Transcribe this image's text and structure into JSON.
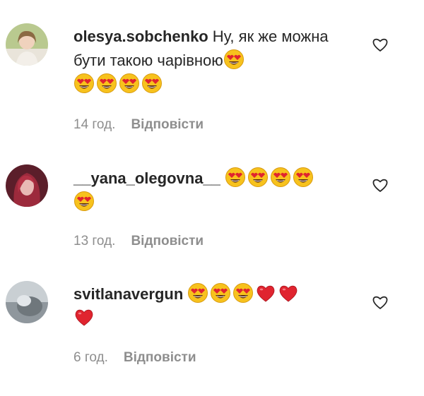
{
  "comments": [
    {
      "username": "olesya.sobchenko",
      "text": "Ну, як же можна бути такою чарівною",
      "emojis_inline": [
        "heart-eyes"
      ],
      "emojis_after": [
        "heart-eyes",
        "heart-eyes",
        "heart-eyes",
        "heart-eyes"
      ],
      "time": "14 год.",
      "reply_label": "Відповісти",
      "avatar_icon": "avatar-photo-blonde"
    },
    {
      "username": "__yana_olegovna__",
      "text": "",
      "emojis_inline": [
        "heart-eyes",
        "heart-eyes",
        "heart-eyes",
        "heart-eyes",
        "heart-eyes"
      ],
      "time": "13 год.",
      "reply_label": "Відповісти",
      "avatar_icon": "avatar-photo-redhair"
    },
    {
      "username": "svitlanavergun",
      "text": "",
      "emojis_inline": [
        "heart-eyes",
        "heart-eyes",
        "heart-eyes",
        "red-heart",
        "red-heart",
        "red-heart"
      ],
      "time": "6 год.",
      "reply_label": "Відповісти",
      "avatar_icon": "avatar-photo-grey"
    }
  ],
  "icons": {
    "like": "heart-outline-icon",
    "emoji_face": "smiling-face-with-heart-eyes",
    "emoji_heart": "red-heart"
  },
  "colors": {
    "text": "#262626",
    "meta": "#8e8e8e",
    "emoji_face": "#f7c21d",
    "emoji_heart": "#e0242f"
  }
}
